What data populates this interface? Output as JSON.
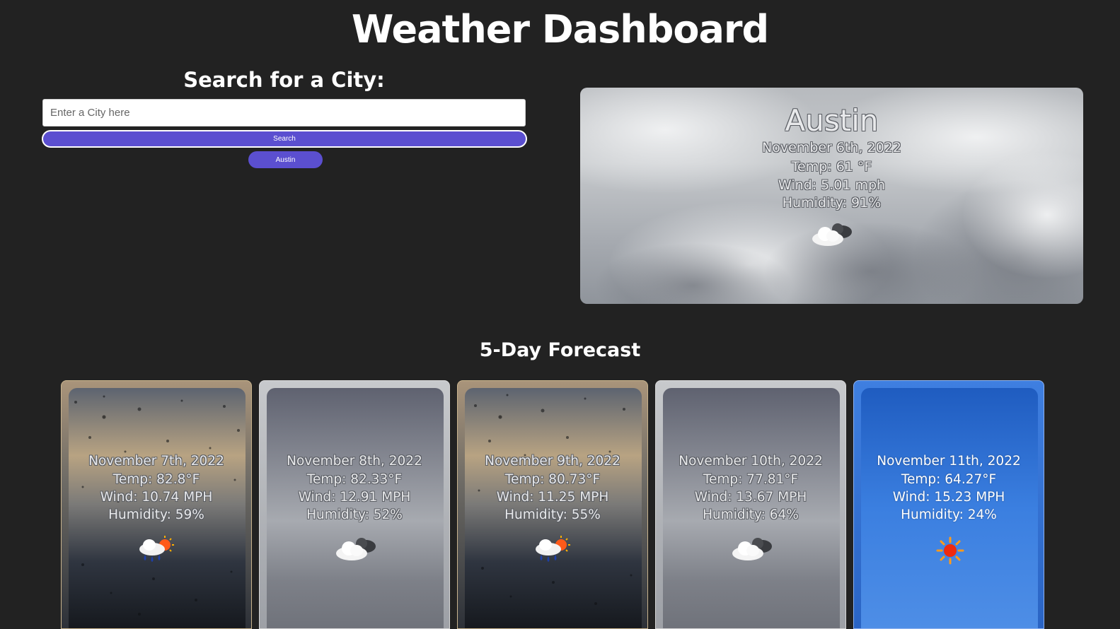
{
  "header": {
    "title": "Weather Dashboard"
  },
  "search": {
    "heading": "Search for a City:",
    "placeholder": "Enter a City here",
    "value": "",
    "button_label": "Search",
    "history": [
      "Austin"
    ]
  },
  "current": {
    "city": "Austin",
    "date": "November 6th, 2022",
    "temp": "Temp: 61 °F",
    "wind": "Wind: 5.01 mph",
    "humidity": "Humidity: 91%",
    "icon": "cloudy-icon"
  },
  "forecast": {
    "heading": "5-Day Forecast",
    "days": [
      {
        "date": "November 7th, 2022",
        "temp": "Temp: 82.8°F",
        "wind": "Wind: 10.74 MPH",
        "humidity": "Humidity: 59%",
        "icon": "rain-sun-icon",
        "background": "rain"
      },
      {
        "date": "November 8th, 2022",
        "temp": "Temp: 82.33°F",
        "wind": "Wind: 12.91 MPH",
        "humidity": "Humidity: 52%",
        "icon": "cloudy-icon",
        "background": "clouds"
      },
      {
        "date": "November 9th, 2022",
        "temp": "Temp: 80.73°F",
        "wind": "Wind: 11.25 MPH",
        "humidity": "Humidity: 55%",
        "icon": "rain-sun-icon",
        "background": "rain"
      },
      {
        "date": "November 10th, 2022",
        "temp": "Temp: 77.81°F",
        "wind": "Wind: 13.67 MPH",
        "humidity": "Humidity: 64%",
        "icon": "cloudy-icon",
        "background": "clouds"
      },
      {
        "date": "November 11th, 2022",
        "temp": "Temp: 64.27°F",
        "wind": "Wind: 15.23 MPH",
        "humidity": "Humidity: 24%",
        "icon": "sun-icon",
        "background": "clear"
      }
    ]
  },
  "colors": {
    "background": "#222222",
    "accent": "#5b4fd0",
    "text": "#ffffff"
  }
}
